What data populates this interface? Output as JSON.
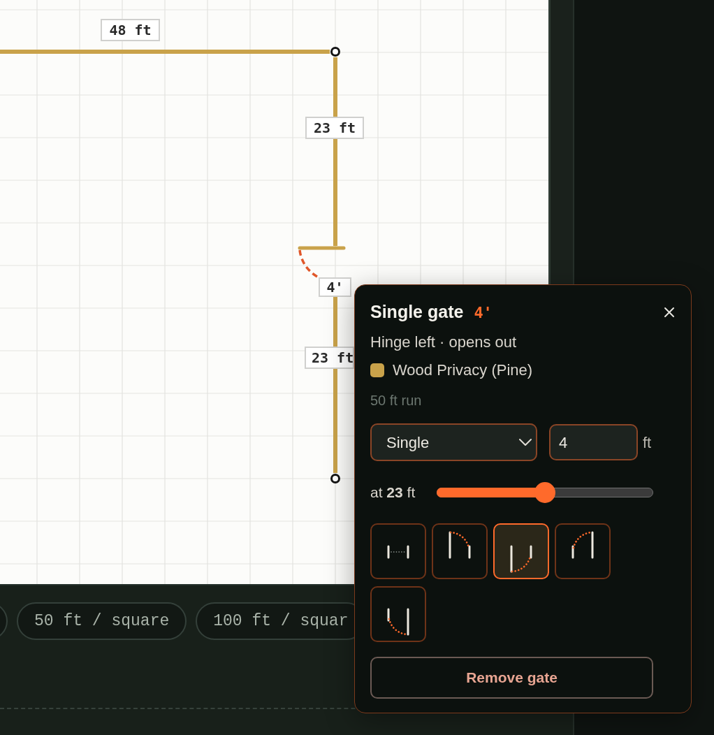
{
  "canvas": {
    "dimension_labels": [
      {
        "text": "48 ft"
      },
      {
        "text": "23 ft"
      },
      {
        "text": "4'"
      },
      {
        "text": "23 ft"
      }
    ]
  },
  "toolbar": {
    "scale_chips": [
      {
        "label": "50 ft / square"
      },
      {
        "label": "100 ft / squar"
      }
    ]
  },
  "gate_popup": {
    "title": "Single gate",
    "size": "4'",
    "hinge": "Hinge left · opens out",
    "material": "Wood Privacy (Pine)",
    "run": "50 ft run",
    "gate_type": {
      "value": "Single"
    },
    "width": {
      "value": "4",
      "unit": "ft"
    },
    "position": {
      "label": "at **23** ft",
      "level": 0.5
    },
    "swing_options": [
      {
        "kind": "flat",
        "selected": false
      },
      {
        "kind": "left-in",
        "selected": false
      },
      {
        "kind": "left-out",
        "selected": true
      },
      {
        "kind": "right-in",
        "selected": false
      },
      {
        "kind": "right-out",
        "selected": false
      }
    ],
    "remove_button": {
      "label": "Remove gate"
    }
  }
}
